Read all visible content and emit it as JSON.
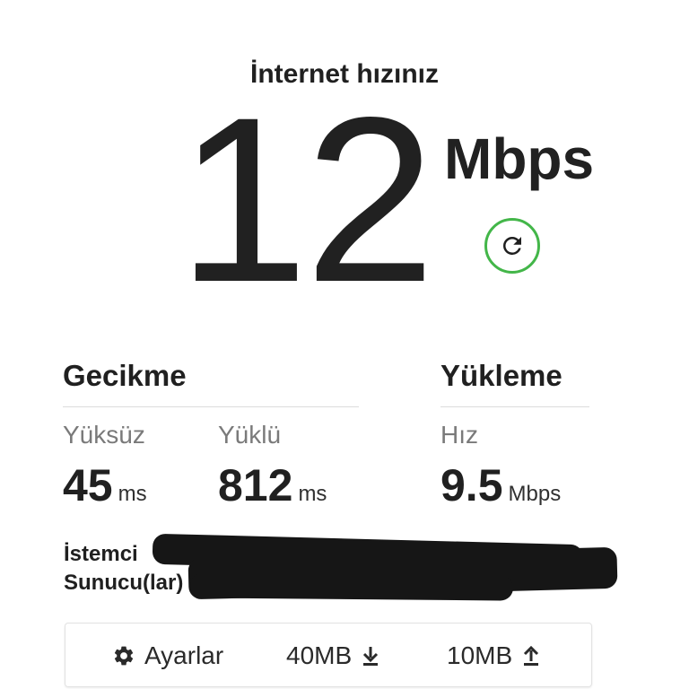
{
  "header": {
    "title": "İnternet hızınız"
  },
  "speed": {
    "value": "12",
    "unit": "Mbps"
  },
  "latency": {
    "title": "Gecikme",
    "unloaded": {
      "label": "Yüksüz",
      "value": "45",
      "unit": "ms"
    },
    "loaded": {
      "label": "Yüklü",
      "value": "812",
      "unit": "ms"
    }
  },
  "upload": {
    "title": "Yükleme",
    "speed": {
      "label": "Hız",
      "value": "9.5",
      "unit": "Mbps"
    }
  },
  "info": {
    "client_label": "İstemci",
    "server_label": "Sunucu(lar)"
  },
  "toolbar": {
    "settings_label": "Ayarlar",
    "download_size": "40MB",
    "upload_size": "10MB"
  },
  "icons": {
    "refresh": "refresh-icon",
    "settings": "gear-icon",
    "download": "download-arrow-icon",
    "upload": "upload-arrow-icon"
  },
  "colors": {
    "accent": "#43b649",
    "text": "#202020",
    "muted": "#7a7a7a"
  }
}
